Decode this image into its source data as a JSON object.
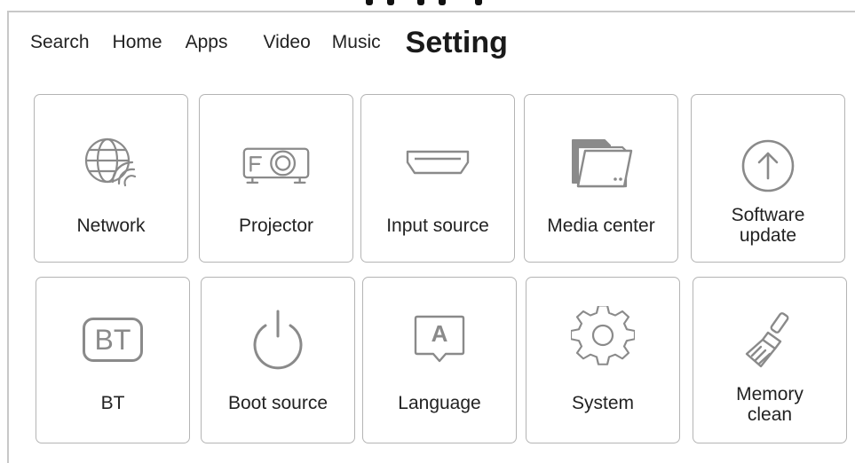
{
  "nav": {
    "tabs": [
      {
        "label": "Search"
      },
      {
        "label": "Home"
      },
      {
        "label": "Apps"
      },
      {
        "label": "Video"
      },
      {
        "label": "Music"
      },
      {
        "label": "Setting",
        "active": true
      }
    ]
  },
  "tiles": {
    "network": {
      "label": "Network",
      "icon": "globe-wifi-icon"
    },
    "projector": {
      "label": "Projector",
      "icon": "projector-icon"
    },
    "input_source": {
      "label": "Input source",
      "icon": "hdmi-port-icon"
    },
    "media_center": {
      "label": "Media center",
      "icon": "folder-icon"
    },
    "software_update": {
      "label": "Software update",
      "icon": "upload-arrow-circle-icon"
    },
    "bt": {
      "label": "BT",
      "icon": "bt-icon"
    },
    "boot_source": {
      "label": "Boot source",
      "icon": "power-icon"
    },
    "language": {
      "label": "Language",
      "icon": "language-a-icon"
    },
    "system": {
      "label": "System",
      "icon": "gear-icon"
    },
    "memory_clean": {
      "label": "Memory clean",
      "icon": "broom-icon"
    }
  },
  "icon_text": {
    "bt": "BT",
    "language": "A"
  },
  "colors": {
    "icon_stroke": "#8a8a8a",
    "tile_border": "#b4b4b4",
    "text": "#222222"
  }
}
